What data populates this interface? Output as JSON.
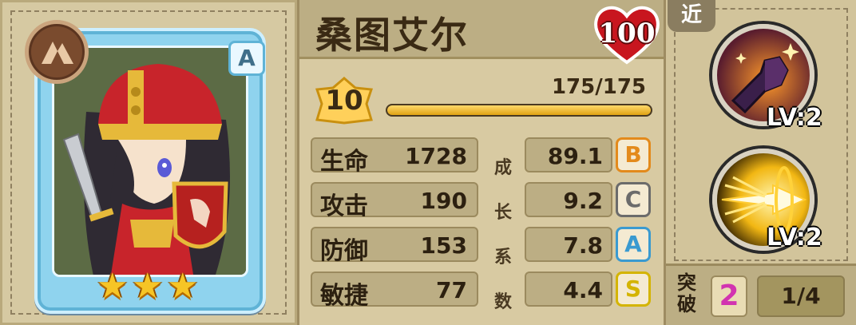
{
  "character": {
    "name": "桑图艾尔",
    "rank": "A",
    "stars": 3,
    "class_icon": "mountain-icon",
    "affinity": "100",
    "level": "10",
    "exp_text": "175/175",
    "exp_fraction": 1.0
  },
  "stats": [
    {
      "label": "生命",
      "value": "1728"
    },
    {
      "label": "攻击",
      "value": "190"
    },
    {
      "label": "防御",
      "value": "153"
    },
    {
      "label": "敏捷",
      "value": "77"
    }
  ],
  "growth_label": [
    "成",
    "长",
    "系",
    "数"
  ],
  "growth": [
    {
      "value": "89.1",
      "grade": "B",
      "color": "#e38a1c"
    },
    {
      "value": "9.2",
      "grade": "C",
      "color": "#6b6b6b"
    },
    {
      "value": "7.8",
      "grade": "A",
      "color": "#3a9ad0"
    },
    {
      "value": "4.4",
      "grade": "S",
      "color": "#d4b400"
    }
  ],
  "range_tag": "近",
  "skills": [
    {
      "icon": "fist-punch-icon",
      "level": "LV:2"
    },
    {
      "icon": "piercing-arrow-icon",
      "level": "LV:2"
    }
  ],
  "breakthrough": {
    "label": "突破",
    "count": "2",
    "progress": "1/4"
  }
}
